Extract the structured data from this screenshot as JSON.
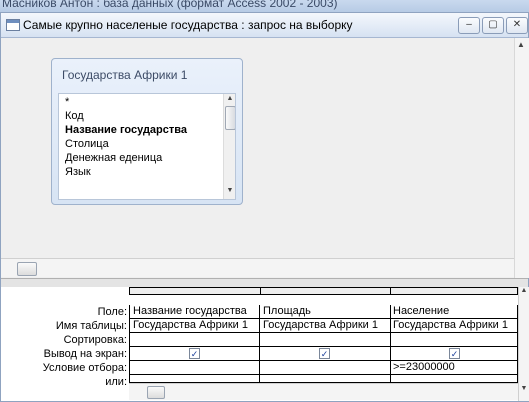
{
  "app": {
    "title": "Масников Антон : база данных (формат Access 2002 - 2003)"
  },
  "window": {
    "title": "Самые крупно населеные государства : запрос на выборку",
    "buttons": {
      "minimize": "–",
      "restore": "▢",
      "close": "✕"
    }
  },
  "table_box": {
    "title": "Государства Африки 1",
    "fields": [
      {
        "label": "*",
        "bold": false
      },
      {
        "label": "Код",
        "bold": false
      },
      {
        "label": "Название государства",
        "bold": true
      },
      {
        "label": "Столица",
        "bold": false
      },
      {
        "label": "Денежная еденица",
        "bold": false
      },
      {
        "label": "Язык",
        "bold": false
      }
    ]
  },
  "grid": {
    "row_labels": {
      "field": "Поле:",
      "table": "Имя таблицы:",
      "sort": "Сортировка:",
      "show": "Вывод на экран:",
      "criteria": "Условие отбора:",
      "or": "или:"
    },
    "columns": [
      {
        "field": "Название государства",
        "table": "Государства Африки 1",
        "sort": "",
        "show": true,
        "criteria": "",
        "or": ""
      },
      {
        "field": "Площадь",
        "table": "Государства Африки 1",
        "sort": "",
        "show": true,
        "criteria": "",
        "or": ""
      },
      {
        "field": "Население",
        "table": "Государства Африки 1",
        "sort": "",
        "show": true,
        "criteria": ">=23000000",
        "or": ""
      }
    ],
    "check_mark": "✓"
  },
  "icons": [
    "window-icon",
    "scroll-up-arrow-icon",
    "scroll-down-arrow-icon"
  ]
}
